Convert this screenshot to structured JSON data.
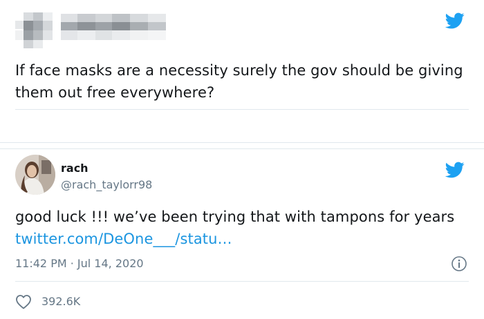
{
  "tweet1": {
    "author": {
      "avatar": "pixelated-avatar",
      "name": "pixelated-name"
    },
    "text": "If face masks are a necessity surely the gov should be giving them out free everywhere?",
    "brand_icon": "twitter-bird-icon"
  },
  "tweet2": {
    "author": {
      "display_name": "rach",
      "handle": "@rach_taylorr98"
    },
    "text": "good luck !!! we’ve been trying that with tampons for years ",
    "link": "twitter.com/DeOne___/statu…",
    "timestamp": "11:42 PM · Jul 14, 2020",
    "likes": "392.6K",
    "brand_icon": "twitter-bird-icon"
  },
  "colors": {
    "twitter_blue": "#1da1f2",
    "link": "#1b95e0",
    "text": "#14171a",
    "secondary": "#657786",
    "border": "#e1e8ed"
  }
}
